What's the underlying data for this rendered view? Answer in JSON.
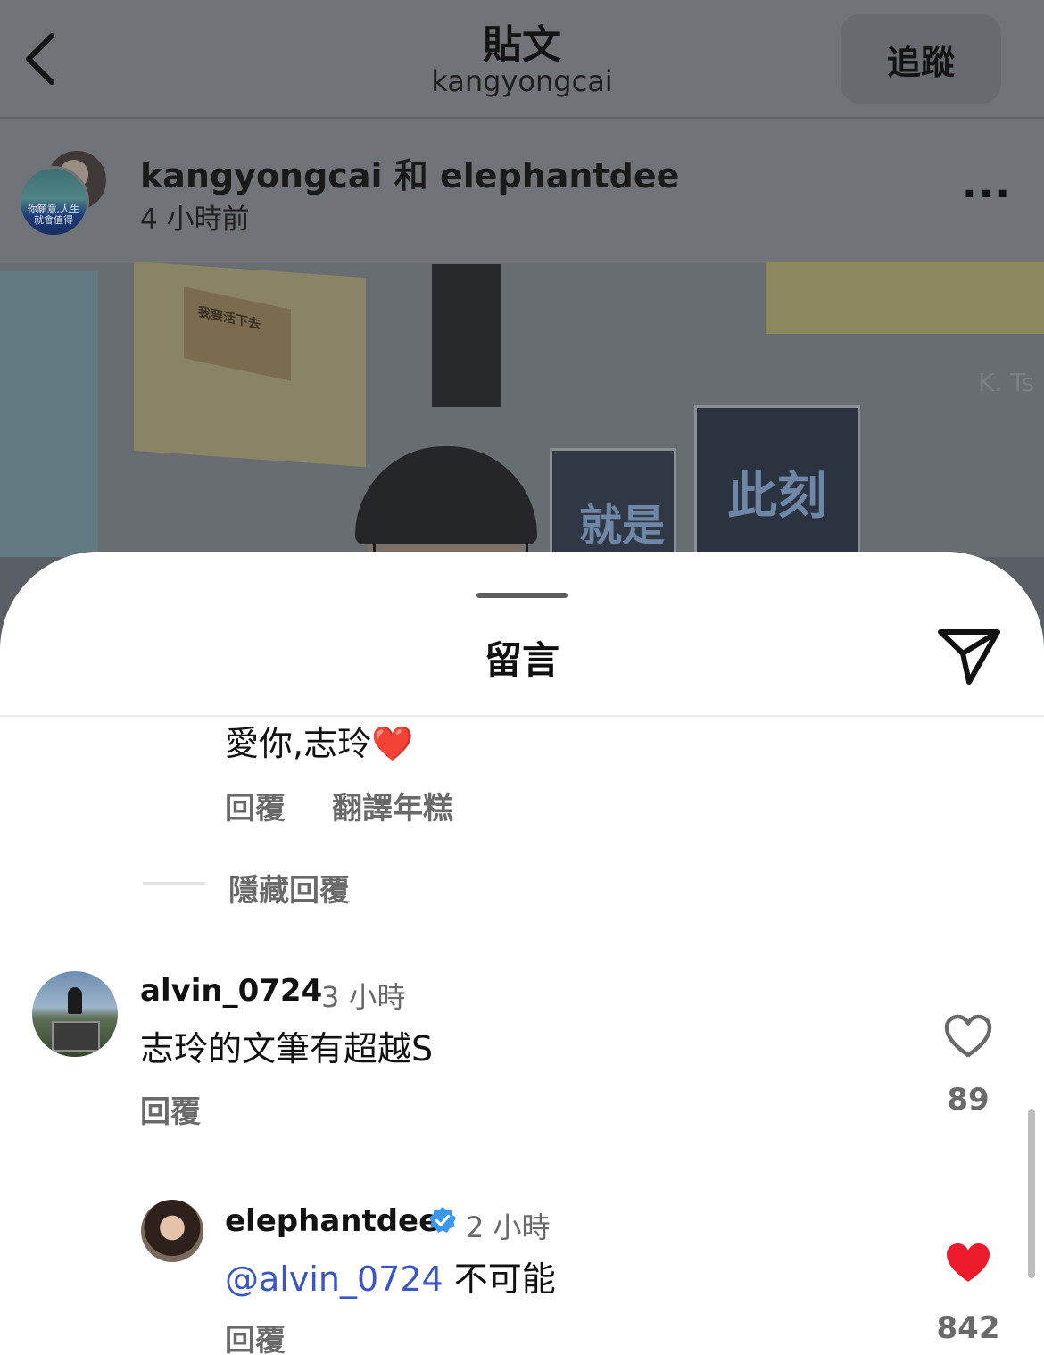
{
  "header": {
    "title": "貼文",
    "subtitle": "kangyongcai",
    "follow_label": "追蹤",
    "back_icon": "chevron-left-icon"
  },
  "post": {
    "authors": "kangyongcai 和 elephantdee",
    "time": "4 小時前",
    "more_icon": "more-horizontal-icon",
    "avatar_caption": "你願意,人生就會值得",
    "photo_texts": {
      "book": "我要活下去",
      "case_left": "就是",
      "case_right": "此刻",
      "watermark": "K. Ts"
    }
  },
  "sheet": {
    "title": "留言",
    "send_icon": "send-icon"
  },
  "comments": {
    "partial": {
      "text": "愛你,志玲",
      "emoji": "❤️",
      "reply_label": "回覆",
      "translate_label": "翻譯年糕"
    },
    "hide_replies_label": "隱藏回覆",
    "alvin": {
      "username": "alvin_0724",
      "time": "3 小時",
      "text": "志玲的文筆有超越S",
      "reply_label": "回覆",
      "likes": "89",
      "liked": false
    },
    "elephantdee": {
      "username": "elephantdee",
      "verified": true,
      "time": "2 小時",
      "mention": "@alvin_0724",
      "text": " 不可能",
      "reply_label": "回覆",
      "likes": "842",
      "liked": true
    }
  },
  "colors": {
    "like_active": "#ed1c2c",
    "mention": "#3b55c8",
    "verified": "#3897f0"
  }
}
